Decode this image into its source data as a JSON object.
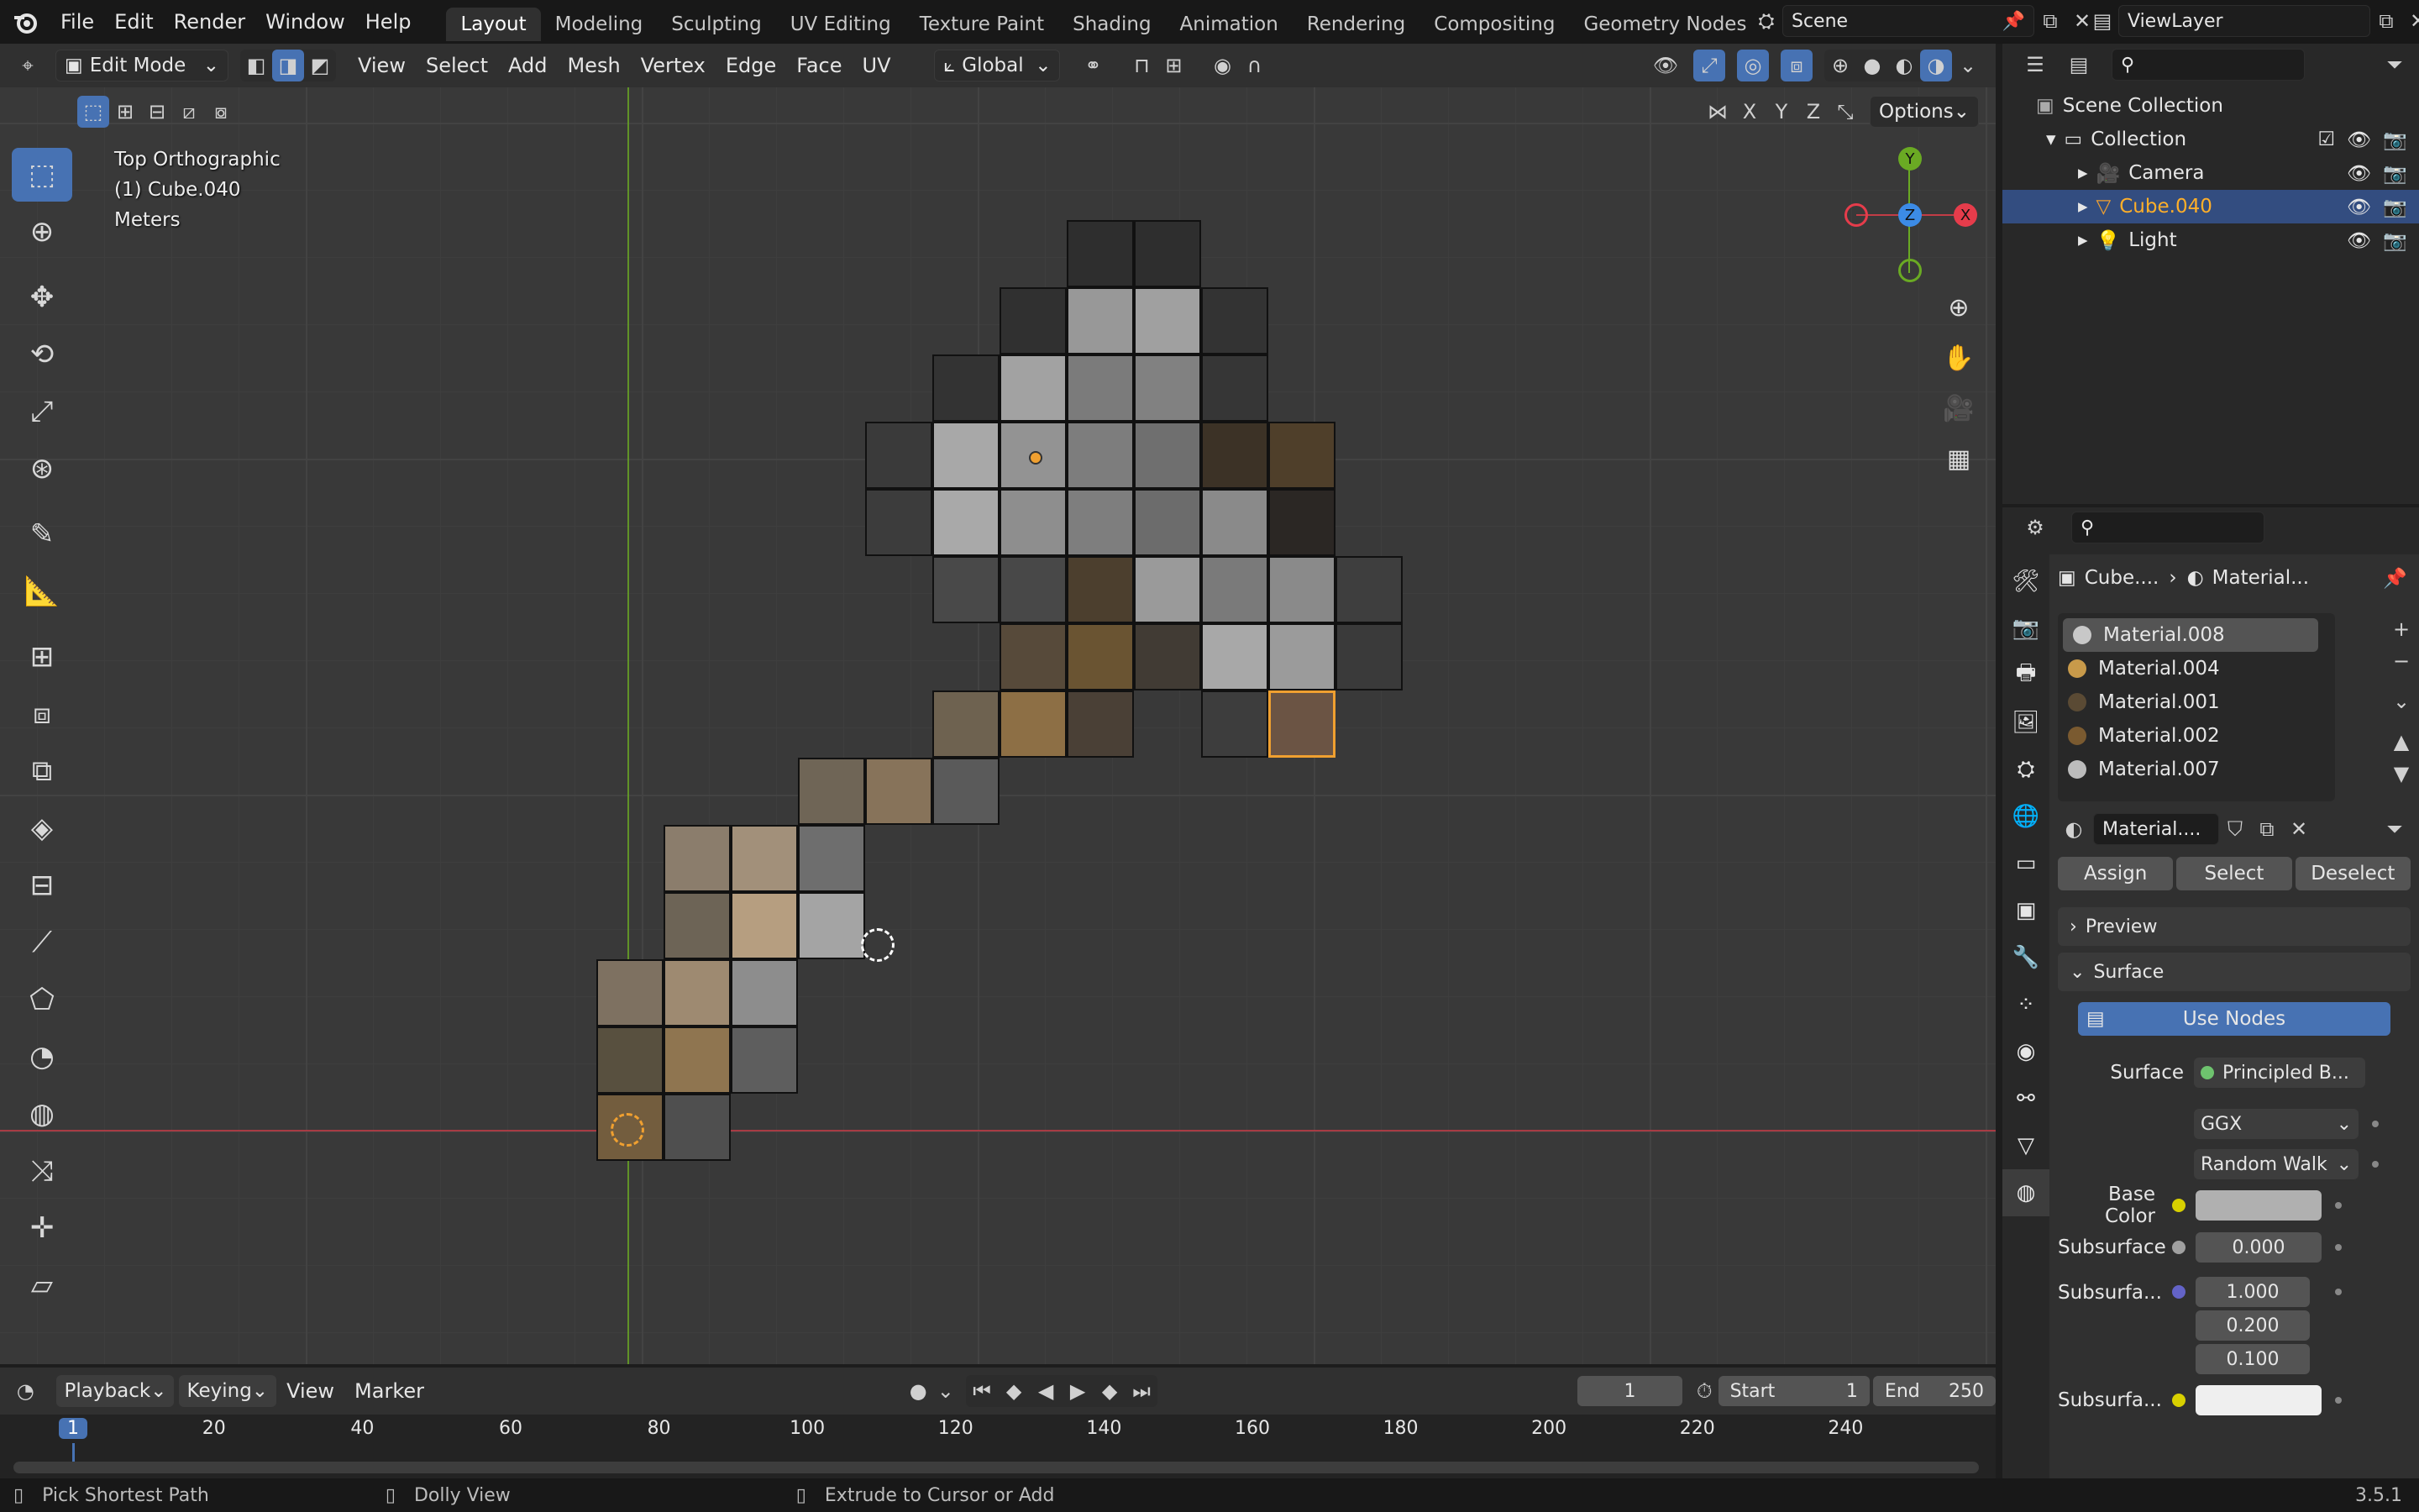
{
  "topbar": {
    "logo_icon": "blender-logo-icon",
    "menus": [
      "File",
      "Edit",
      "Render",
      "Window",
      "Help"
    ],
    "workspaces": [
      "Layout",
      "Modeling",
      "Sculpting",
      "UV Editing",
      "Texture Paint",
      "Shading",
      "Animation",
      "Rendering",
      "Compositing",
      "Geometry Nodes"
    ],
    "active_workspace": "Layout",
    "scene": "Scene",
    "view_layer": "ViewLayer"
  },
  "viewport_header": {
    "mode": "Edit Mode",
    "menus": [
      "View",
      "Select",
      "Add",
      "Mesh",
      "Vertex",
      "Edge",
      "Face",
      "UV"
    ],
    "orientation": "Global",
    "options": "Options",
    "axes": [
      "X",
      "Y",
      "Z"
    ]
  },
  "viewport": {
    "view_name": "Top Orthographic",
    "object_name": "(1) Cube.040",
    "units": "Meters",
    "gizmo_axes": [
      "Y",
      "Z",
      "X"
    ]
  },
  "tools": [
    "select-box-icon",
    "cursor-icon",
    "move-icon",
    "rotate-icon",
    "scale-icon",
    "transform-icon",
    "annotate-icon",
    "measure-icon",
    "add-cube-icon",
    "extrude-icon",
    "inset-icon",
    "bevel-icon",
    "loop-cut-icon",
    "knife-icon",
    "poly-build-icon",
    "spin-icon",
    "smooth-icon",
    "edge-slide-icon",
    "shrink-icon",
    "shear-icon"
  ],
  "mesh_grid": {
    "rows": [
      [
        null,
        null,
        null,
        null,
        "#2e2e2e",
        "#2e2e2e",
        null,
        null
      ],
      [
        null,
        null,
        null,
        "#303030",
        "#989898",
        "#a0a0a0",
        "#333333",
        null
      ],
      [
        null,
        null,
        "#333333",
        "#a2a2a2",
        "#7b7b7b",
        "#818181",
        "#363636",
        null
      ],
      [
        null,
        "#3a3a3a",
        "#a8a8a8",
        "#939393",
        "#7d7d7d",
        "#6f6f6f",
        "#3c3226",
        "#4f3f2a"
      ],
      [
        null,
        "#3c3c3c",
        "#a9a9a9",
        "#8e8e8e",
        "#7e7e7e",
        "#6c6c6c",
        "#8a8a8a",
        "#2b2724"
      ],
      [
        null,
        null,
        "#494949",
        "#484848",
        "#4c3f2e",
        "#9a9a9a",
        "#7a7a7a",
        "#8a8a8a",
        "#3e3e3e"
      ],
      [
        null,
        null,
        null,
        "#574a3a",
        "#6a5432",
        "#413b34",
        "#a8a8a8",
        "#9b9b9b",
        "#3a3a3a"
      ],
      [
        null,
        null,
        "#6e6250",
        "#8d6f45",
        "#4a4036",
        null,
        "#3d3d3d",
        "#6b5444"
      ],
      [
        null,
        "#6f6556",
        "#87735a",
        "#5a5a5a"
      ],
      [
        "#8b7d6c",
        "#a2907a",
        "#6e6e6e"
      ],
      [
        "#6d6456",
        "#b69e80",
        "#a4a4a4"
      ],
      [
        "#7e7161",
        "#9e8a71",
        "#8d8d8d"
      ],
      [
        "#58503f",
        "#8f7550",
        "#5e5e5e"
      ],
      [
        "#735d3e",
        "#4f4f4f"
      ]
    ]
  },
  "timeline": {
    "menus": [
      "Playback",
      "Keying",
      "View",
      "Marker"
    ],
    "current_frame": "1",
    "start_label": "Start",
    "start": "1",
    "end_label": "End",
    "end": "250",
    "ticks": [
      "1",
      "20",
      "40",
      "60",
      "80",
      "100",
      "120",
      "140",
      "160",
      "180",
      "200",
      "220",
      "240"
    ]
  },
  "outliner": {
    "items": [
      {
        "label": "Scene Collection",
        "icon": "scene-collection-icon"
      },
      {
        "label": "Collection",
        "icon": "collection-icon"
      },
      {
        "label": "Camera",
        "icon": "camera-icon"
      },
      {
        "label": "Cube.040",
        "icon": "mesh-icon"
      },
      {
        "label": "Light",
        "icon": "light-icon"
      }
    ]
  },
  "properties": {
    "breadcrumb": [
      "Cube....",
      "Material..."
    ],
    "materials": [
      "Material.008",
      "Material.004",
      "Material.001",
      "Material.002",
      "Material.007"
    ],
    "material_name": "Material....",
    "buttons": [
      "Assign",
      "Select",
      "Deselect"
    ],
    "panels": {
      "preview": "Preview",
      "surface": "Surface"
    },
    "use_nodes": "Use Nodes",
    "surface_label": "Surface",
    "surface_value": "Principled B...",
    "distribution": "GGX",
    "subsurface_method": "Random Walk",
    "base_color_label": "Base Color",
    "subsurface_label": "Subsurface",
    "subsurface_value": "0.000",
    "subsurface_radius_label": "Subsurfa...",
    "radius": [
      "1.000",
      "0.200",
      "0.100"
    ],
    "subsurface_color_label": "Subsurfa..."
  },
  "status_bar": {
    "left": "Pick Shortest Path",
    "middle": "Dolly View",
    "right": "Extrude to Cursor or Add",
    "version": "3.5.1"
  },
  "colors": {
    "accent": "#4772b3",
    "selected_orange": "#f0a030",
    "x_axis": "#e63c4b",
    "y_axis": "#6aaa23",
    "z_axis": "#3c8be6"
  }
}
